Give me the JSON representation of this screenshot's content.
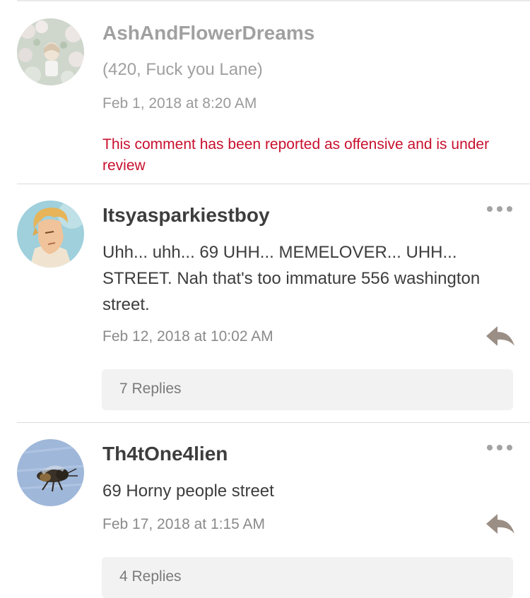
{
  "comments": [
    {
      "username": "AshAndFlowerDreams",
      "text": "(420, Fuck you Lane)",
      "timestamp": "Feb 1, 2018 at 8:20 AM",
      "warning": "This comment has been reported as offensive and is under review",
      "avatar_icon": "flowers-avatar-icon"
    },
    {
      "username": "Itsyasparkiestboy",
      "text": "Uhh... uhh... 69 UHH... MEMELOVER... UHH... STREET. Nah that's too immature 556 washington street.",
      "timestamp": "Feb 12, 2018 at 10:02 AM",
      "replies_label": "7 Replies",
      "avatar_icon": "anime-boy-avatar-icon"
    },
    {
      "username": "Th4tOne4lien",
      "text": "69 Horny people street",
      "timestamp": "Feb 17, 2018 at 1:15 AM",
      "replies_label": "4 Replies",
      "avatar_icon": "bee-avatar-icon"
    }
  ],
  "icons": {
    "more": "more-options-icon",
    "reply": "reply-arrow-icon"
  },
  "colors": {
    "warning": "#c8102e",
    "muted_text": "#a0a0a0",
    "body_text": "#3d3d3d",
    "reply_icon": "#9b8e85",
    "replies_bg": "#f2f2f2"
  }
}
